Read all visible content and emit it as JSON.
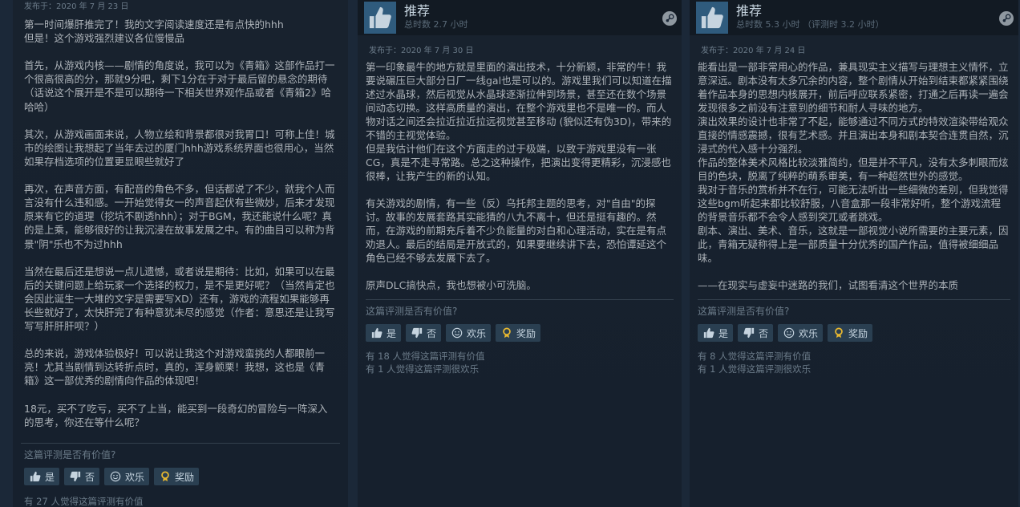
{
  "review_left": {
    "posted": "发布于：2020 年 7 月 23 日",
    "body": "第一时间爆肝推完了！我的文字阅读速度还是有点快的hhh\n但是！这个游戏强烈建议各位慢慢品\n\n首先，从游戏内核——剧情的角度说，我可以为《青箱》这部作品打一个很高很高的分，那就9分吧，剩下1分在于对于最后留的悬念的期待（话说这个展开是不是可以期待一下相关世界观作品或者《青箱2》哈哈哈）\n\n其次，从游戏画面来说，人物立绘和背景都很对我胃口！可称上佳！城市的绘图让我想起了当年去过的厦门hhh游戏系统界面也很用心，当然如果存档选项的位置更显眼些就好了\n\n再次，在声音方面，有配音的角色不多，但话都说了不少，就我个人而言没有什么违和感。一开始觉得女一的声音起伏有些微妙，后来才发现原来有它的道理（挖坑不剧透hhh）；对于BGM，我还能说什么呢？真的是上乘，能够很好的让我沉浸在故事发展之中。有的曲目可以称为背景\"阴\"乐也不为过hhh\n\n当然在最后还是想说一点儿遗憾，或者说是期待：比如，如果可以在最后的关键问题上给玩家一个选择的权力，是不是更好呢？（当然肯定也会因此诞生一大堆的文字是需要写XD）还有，游戏的流程如果能够再长些就好了，太快肝完了有种意犹未尽的感觉（作者：意思还是让我写写写肝肝肝呗？）\n\n总的来说，游戏体验极好！可以说让我这个对游戏蛮挑的人都眼前一亮！尤其当剧情到达转折点时，真的，浑身颤栗！我想，这也是《青箱》这一部优秀的剧情向作品的体现吧！\n\n18元，买不了吃亏，买不了上当，能买到一段奇幻的冒险与一阵深入的思考，你还在等什么呢？",
    "helpful_q": "这篇评测是否有价值?",
    "btn_yes": "是",
    "btn_no": "否",
    "btn_funny": "欢乐",
    "btn_award": "奖励",
    "count_helpful": "有 27 人觉得这篇评测有价值"
  },
  "review_mid": {
    "title": "推荐",
    "hours": "总时数 2.7 小时",
    "posted": "发布于：2020 年 7 月 30 日",
    "body": "第一印象最牛的地方就是里面的演出技术，十分新颖，非常的牛！我要说碾压巨大部分日厂一线gal也是可以的。游戏里我们可以知道在描述过水晶球，然后视觉从水晶球逐渐拉伸到场景，甚至还在数个场景间动态切换。这样高质量的演出，在整个游戏里也不是唯一的。而人物对话之间还会拉近拉近拉远视觉甚至移动 (貌似还有伪3D)，带来的不错的主视觉体验。\n但是我估计他们在这个方面走的过于极端，以致于游戏里没有一张CG，真是不走寻常路。总之这种操作，把演出变得更精彩，沉浸感也很棒，让我产生的新的认知。\n\n有关游戏的剧情，有一些（反）乌托邦主题的思考，对\"自由\"的探讨。故事的发展套路其实能猜的八九不离十，但还是挺有趣的。然而，在游戏的前期充斥着不少负能量的对白和心理活动，实在是有点劝退人。最后的结局是开放式的，如果要继续讲下去，恐怕谭延这个角色已经不够去发展下去了。\n\n原声DLC搞快点，我也想被小可洗脑。",
    "helpful_q": "这篇评测是否有价值?",
    "btn_yes": "是",
    "btn_no": "否",
    "btn_funny": "欢乐",
    "btn_award": "奖励",
    "count_helpful": "有 18 人觉得这篇评测有价值",
    "count_funny": "有 1 人觉得这篇评测很欢乐"
  },
  "review_right": {
    "title": "推荐",
    "hours": "总时数 5.3 小时 （评测时 3.2 小时）",
    "posted": "发布于：2020 年 7 月 24 日",
    "body": "能看出是一部非常用心的作品，兼具现实主义描写与理想主义情怀，立意深远。剧本没有太多冗余的内容，整个剧情从开始到结束都紧紧围绕着作品本身的思想内核展开，前后呼应联系紧密，打通之后再读一遍会发现很多之前没有注意到的细节和耐人寻味的地方。\n演出效果的设计也非常了不起，能够通过不同方式的特效渲染带给观众直接的情感震撼，很有艺术感。并且演出本身和剧本契合连贯自然，沉浸式的代入感十分强烈。\n作品的整体美术风格比较淡雅简约，但是并不平凡，没有太多刺眼而炫目的色块，脱离了纯粹的萌系审美，有一种超然世外的感觉。\n我对于音乐的赏析并不在行，可能无法听出一些细微的差别，但我觉得这些bgm听起来都比较舒服，八音盒那一段非常好听，整个游戏流程的背景音乐都不会令人感到突兀或者跳戏。\n剧本、演出、美术、音乐，这就是一部视觉小说所需要的主要元素，因此，青箱无疑称得上是一部质量十分优秀的国产作品，值得被细细品味。\n\n——在现实与虚妄中迷路的我们，试图看清这个世界的本质",
    "helpful_q": "这篇评测是否有价值?",
    "btn_yes": "是",
    "btn_no": "否",
    "btn_funny": "欢乐",
    "btn_award": "奖励",
    "count_helpful": "有 8 人觉得这篇评测有价值",
    "count_funny": "有 1 人觉得这篇评测很欢乐"
  },
  "colors": {
    "page_bg": "#1b2838",
    "text": "#acb2b8",
    "muted": "#6b7b89",
    "button": "#2a3f51",
    "thumb_box": "#2f5b7d",
    "award_gold": "#e8b830"
  },
  "icons": [
    "thumbs-up-icon",
    "thumbs-down-icon",
    "smiley-icon",
    "award-icon",
    "steam-logo-icon"
  ]
}
